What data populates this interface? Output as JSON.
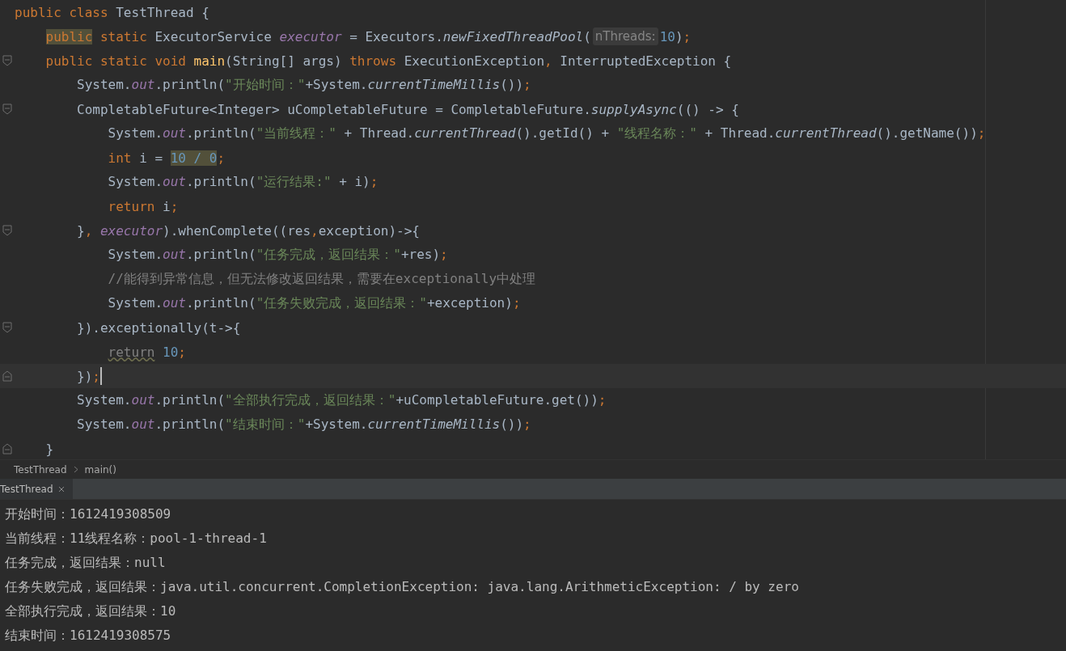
{
  "editor": {
    "lines": [
      {
        "fold_marker": false,
        "current": false,
        "tokens": [
          {
            "kind": "kw",
            "text": "public class "
          },
          {
            "kind": "plain",
            "text": "TestThread {"
          }
        ],
        "children": [
          {
            "fold_marker": false,
            "current": false,
            "tokens": [
              {
                "kind": "kw-marked",
                "text": "public"
              },
              {
                "kind": "kw",
                "text": " static "
              },
              {
                "kind": "plain",
                "text": "ExecutorService "
              },
              {
                "kind": "field",
                "text": "executor"
              },
              {
                "kind": "plain",
                "text": " = Executors."
              },
              {
                "kind": "static",
                "text": "newFixedThreadPool"
              },
              {
                "kind": "plain",
                "text": "("
              },
              {
                "kind": "hint",
                "text": "nThreads:"
              },
              {
                "kind": "num",
                "text": "10"
              },
              {
                "kind": "plain",
                "text": ")"
              },
              {
                "kind": "kw",
                "text": ";"
              }
            ]
          },
          {
            "fold_marker": true,
            "current": false,
            "tokens": [
              {
                "kind": "kw",
                "text": "public static void "
              },
              {
                "kind": "method",
                "text": "main"
              },
              {
                "kind": "plain",
                "text": "(String[] args) "
              },
              {
                "kind": "kw",
                "text": "throws "
              },
              {
                "kind": "plain",
                "text": "ExecutionException"
              },
              {
                "kind": "kw",
                "text": ", "
              },
              {
                "kind": "plain",
                "text": "InterruptedException {"
              }
            ],
            "children": [
              {
                "fold_marker": false,
                "current": false,
                "tokens": [
                  {
                    "kind": "plain",
                    "text": "System."
                  },
                  {
                    "kind": "field",
                    "text": "out"
                  },
                  {
                    "kind": "plain",
                    "text": ".println("
                  },
                  {
                    "kind": "str",
                    "text": "\"开始时间：\""
                  },
                  {
                    "kind": "plain",
                    "text": "+System."
                  },
                  {
                    "kind": "static",
                    "text": "currentTimeMillis"
                  },
                  {
                    "kind": "plain",
                    "text": "())"
                  },
                  {
                    "kind": "kw",
                    "text": ";"
                  }
                ]
              },
              {
                "fold_marker": true,
                "current": false,
                "tokens": [
                  {
                    "kind": "plain",
                    "text": "CompletableFuture<Integer> uCompletableFuture = CompletableFuture."
                  },
                  {
                    "kind": "static",
                    "text": "supplyAsync"
                  },
                  {
                    "kind": "plain",
                    "text": "(() -> {"
                  }
                ],
                "children": [
                  {
                    "fold_marker": false,
                    "current": false,
                    "tokens": [
                      {
                        "kind": "plain",
                        "text": "System."
                      },
                      {
                        "kind": "field",
                        "text": "out"
                      },
                      {
                        "kind": "plain",
                        "text": ".println("
                      },
                      {
                        "kind": "str",
                        "text": "\"当前线程：\""
                      },
                      {
                        "kind": "plain",
                        "text": " + Thread."
                      },
                      {
                        "kind": "static",
                        "text": "currentThread"
                      },
                      {
                        "kind": "plain",
                        "text": "().getId() + "
                      },
                      {
                        "kind": "str",
                        "text": "\"线程名称：\""
                      },
                      {
                        "kind": "plain",
                        "text": " + Thread."
                      },
                      {
                        "kind": "static",
                        "text": "currentThread"
                      },
                      {
                        "kind": "plain",
                        "text": "().getName())"
                      },
                      {
                        "kind": "kw",
                        "text": ";"
                      }
                    ]
                  },
                  {
                    "fold_marker": false,
                    "current": false,
                    "tokens": [
                      {
                        "kind": "kw",
                        "text": "int "
                      },
                      {
                        "kind": "plain",
                        "text": "i = "
                      },
                      {
                        "kind": "num-marked",
                        "text": "10 / 0"
                      },
                      {
                        "kind": "kw",
                        "text": ";"
                      }
                    ]
                  },
                  {
                    "fold_marker": false,
                    "current": false,
                    "tokens": [
                      {
                        "kind": "plain",
                        "text": "System."
                      },
                      {
                        "kind": "field",
                        "text": "out"
                      },
                      {
                        "kind": "plain",
                        "text": ".println("
                      },
                      {
                        "kind": "str",
                        "text": "\"运行结果:\""
                      },
                      {
                        "kind": "plain",
                        "text": " + i)"
                      },
                      {
                        "kind": "kw",
                        "text": ";"
                      }
                    ]
                  },
                  {
                    "fold_marker": false,
                    "current": false,
                    "tokens": [
                      {
                        "kind": "kw",
                        "text": "return "
                      },
                      {
                        "kind": "plain",
                        "text": "i"
                      },
                      {
                        "kind": "kw",
                        "text": ";"
                      }
                    ]
                  }
                ]
              },
              {
                "fold_marker": true,
                "current": false,
                "tokens": [
                  {
                    "kind": "plain",
                    "text": "}"
                  },
                  {
                    "kind": "kw",
                    "text": ", "
                  },
                  {
                    "kind": "field",
                    "text": "executor"
                  },
                  {
                    "kind": "plain",
                    "text": ").whenComplete((res"
                  },
                  {
                    "kind": "kw",
                    "text": ","
                  },
                  {
                    "kind": "plain",
                    "text": "exception)->{"
                  }
                ],
                "children": [
                  {
                    "fold_marker": false,
                    "current": false,
                    "tokens": [
                      {
                        "kind": "plain",
                        "text": "System."
                      },
                      {
                        "kind": "field",
                        "text": "out"
                      },
                      {
                        "kind": "plain",
                        "text": ".println("
                      },
                      {
                        "kind": "str",
                        "text": "\"任务完成，返回结果：\""
                      },
                      {
                        "kind": "plain",
                        "text": "+res)"
                      },
                      {
                        "kind": "kw",
                        "text": ";"
                      }
                    ]
                  },
                  {
                    "fold_marker": false,
                    "current": false,
                    "tokens": [
                      {
                        "kind": "comment",
                        "text": "//能得到异常信息，但无法修改返回结果，需要在exceptionally中处理"
                      }
                    ]
                  },
                  {
                    "fold_marker": false,
                    "current": false,
                    "tokens": [
                      {
                        "kind": "plain",
                        "text": "System."
                      },
                      {
                        "kind": "field",
                        "text": "out"
                      },
                      {
                        "kind": "plain",
                        "text": ".println("
                      },
                      {
                        "kind": "str",
                        "text": "\"任务失败完成，返回结果：\""
                      },
                      {
                        "kind": "plain",
                        "text": "+exception)"
                      },
                      {
                        "kind": "kw",
                        "text": ";"
                      }
                    ]
                  }
                ]
              },
              {
                "fold_marker": true,
                "current": false,
                "tokens": [
                  {
                    "kind": "plain",
                    "text": "}).exceptionally(t->{"
                  }
                ],
                "children": [
                  {
                    "fold_marker": false,
                    "current": false,
                    "tokens": [
                      {
                        "kind": "kw-warn",
                        "text": "return"
                      },
                      {
                        "kind": "num",
                        "text": " 10"
                      },
                      {
                        "kind": "kw",
                        "text": ";"
                      }
                    ]
                  }
                ]
              },
              {
                "fold_marker": true,
                "current": true,
                "tokens": [
                  {
                    "kind": "plain",
                    "text": "})"
                  },
                  {
                    "kind": "kw",
                    "text": ";"
                  }
                ]
              },
              {
                "fold_marker": false,
                "current": false,
                "tokens": [
                  {
                    "kind": "plain",
                    "text": "System."
                  },
                  {
                    "kind": "field",
                    "text": "out"
                  },
                  {
                    "kind": "plain",
                    "text": ".println("
                  },
                  {
                    "kind": "str",
                    "text": "\"全部执行完成，返回结果：\""
                  },
                  {
                    "kind": "plain",
                    "text": "+uCompletableFuture.get())"
                  },
                  {
                    "kind": "kw",
                    "text": ";"
                  }
                ]
              },
              {
                "fold_marker": false,
                "current": false,
                "tokens": [
                  {
                    "kind": "plain",
                    "text": "System."
                  },
                  {
                    "kind": "field",
                    "text": "out"
                  },
                  {
                    "kind": "plain",
                    "text": ".println("
                  },
                  {
                    "kind": "str",
                    "text": "\"结束时间：\""
                  },
                  {
                    "kind": "plain",
                    "text": "+System."
                  },
                  {
                    "kind": "static",
                    "text": "currentTimeMillis"
                  },
                  {
                    "kind": "plain",
                    "text": "())"
                  },
                  {
                    "kind": "kw",
                    "text": ";"
                  }
                ]
              }
            ]
          },
          {
            "fold_marker": true,
            "current": false,
            "tokens": [
              {
                "kind": "plain",
                "text": "}"
              }
            ]
          }
        ]
      }
    ]
  },
  "breadcrumbs": [
    "TestThread",
    "main()"
  ],
  "run_tabs": [
    {
      "label": "TestThread",
      "selected": true
    }
  ],
  "console": {
    "lines": [
      "开始时间：1612419308509",
      "当前线程：11线程名称：pool-1-thread-1",
      "任务完成，返回结果：null",
      "任务失败完成，返回结果：java.util.concurrent.CompletionException: java.lang.ArithmeticException: / by zero",
      "全部执行完成，返回结果：10",
      "结束时间：1612419308575"
    ]
  }
}
